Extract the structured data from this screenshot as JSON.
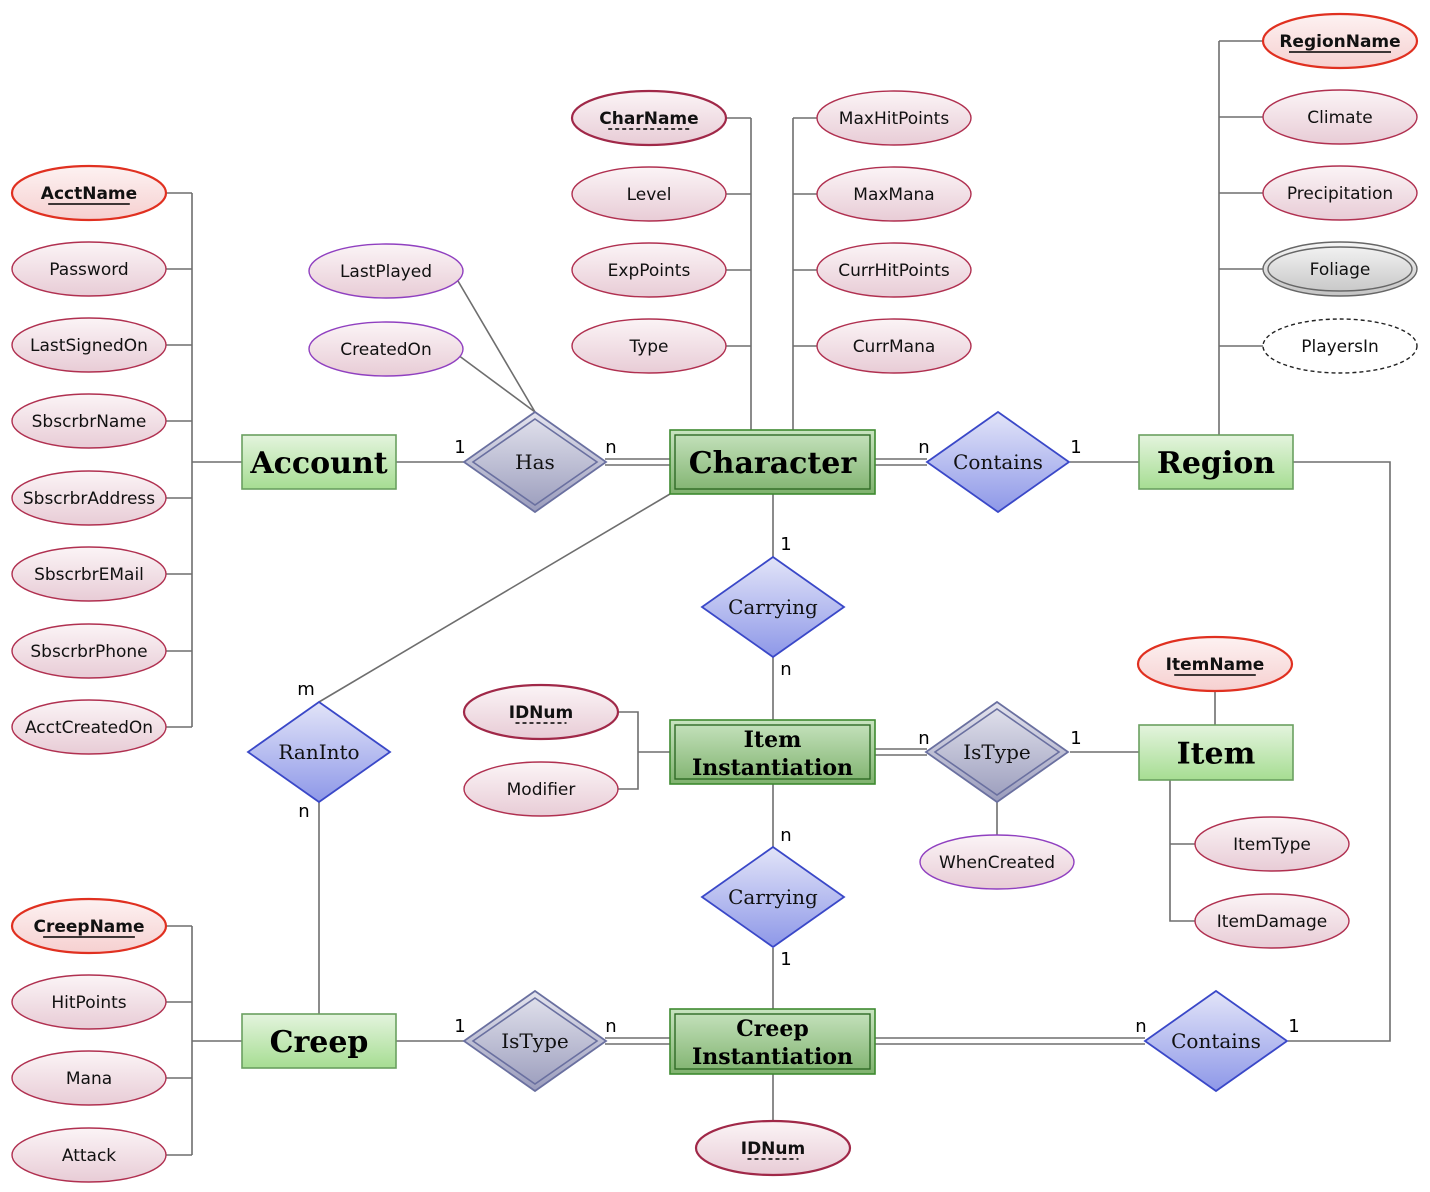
{
  "entities": [
    {
      "id": "account",
      "label": [
        "Account"
      ],
      "weak": false
    },
    {
      "id": "character",
      "label": [
        "Character"
      ],
      "weak": true
    },
    {
      "id": "region",
      "label": [
        "Region"
      ],
      "weak": false
    },
    {
      "id": "iteminst",
      "label": [
        "Item",
        "Instantiation"
      ],
      "weak": true
    },
    {
      "id": "item",
      "label": [
        "Item"
      ],
      "weak": false
    },
    {
      "id": "creep",
      "label": [
        "Creep"
      ],
      "weak": false
    },
    {
      "id": "creepinst",
      "label": [
        "Creep",
        "Instantiation"
      ],
      "weak": true
    }
  ],
  "relationships": [
    {
      "id": "has",
      "label": "Has",
      "identifying": true
    },
    {
      "id": "contains1",
      "label": "Contains",
      "identifying": false
    },
    {
      "id": "carrying1",
      "label": "Carrying",
      "identifying": false
    },
    {
      "id": "istype1",
      "label": "IsType",
      "identifying": true
    },
    {
      "id": "carrying2",
      "label": "Carrying",
      "identifying": false
    },
    {
      "id": "istype2",
      "label": "IsType",
      "identifying": true
    },
    {
      "id": "contains2",
      "label": "Contains",
      "identifying": false
    },
    {
      "id": "raninto",
      "label": "RanInto",
      "identifying": false
    }
  ],
  "attributes": [
    {
      "id": "acctname",
      "label": "AcctName",
      "kind": "key"
    },
    {
      "id": "password",
      "label": "Password",
      "kind": "normal"
    },
    {
      "id": "lastsignedon",
      "label": "LastSignedOn",
      "kind": "normal"
    },
    {
      "id": "sbscrbrname",
      "label": "SbscrbrName",
      "kind": "normal"
    },
    {
      "id": "sbscrbraddress",
      "label": "SbscrbrAddress",
      "kind": "normal"
    },
    {
      "id": "sbscrbremail",
      "label": "SbscrbrEMail",
      "kind": "normal"
    },
    {
      "id": "sbscrbrphone",
      "label": "SbscrbrPhone",
      "kind": "normal"
    },
    {
      "id": "acctcreatedon",
      "label": "AcctCreatedOn",
      "kind": "normal"
    },
    {
      "id": "lastplayed",
      "label": "LastPlayed",
      "kind": "relationship"
    },
    {
      "id": "createdon",
      "label": "CreatedOn",
      "kind": "relationship"
    },
    {
      "id": "charname",
      "label": "CharName",
      "kind": "partial-key"
    },
    {
      "id": "level",
      "label": "Level",
      "kind": "normal"
    },
    {
      "id": "exppoints",
      "label": "ExpPoints",
      "kind": "normal"
    },
    {
      "id": "type",
      "label": "Type",
      "kind": "normal"
    },
    {
      "id": "maxhitpoints",
      "label": "MaxHitPoints",
      "kind": "normal"
    },
    {
      "id": "maxmana",
      "label": "MaxMana",
      "kind": "normal"
    },
    {
      "id": "currhitpoints",
      "label": "CurrHitPoints",
      "kind": "normal"
    },
    {
      "id": "currmana",
      "label": "CurrMana",
      "kind": "normal"
    },
    {
      "id": "regionname",
      "label": "RegionName",
      "kind": "key"
    },
    {
      "id": "climate",
      "label": "Climate",
      "kind": "normal"
    },
    {
      "id": "precipitation",
      "label": "Precipitation",
      "kind": "normal"
    },
    {
      "id": "foliage",
      "label": "Foliage",
      "kind": "multivalued"
    },
    {
      "id": "playersin",
      "label": "PlayersIn",
      "kind": "derived"
    },
    {
      "id": "idnum1",
      "label": "IDNum",
      "kind": "partial-key"
    },
    {
      "id": "modifier",
      "label": "Modifier",
      "kind": "normal"
    },
    {
      "id": "itemname",
      "label": "ItemName",
      "kind": "key"
    },
    {
      "id": "whencreated",
      "label": "WhenCreated",
      "kind": "relationship"
    },
    {
      "id": "itemtype",
      "label": "ItemType",
      "kind": "normal"
    },
    {
      "id": "itemdamage",
      "label": "ItemDamage",
      "kind": "normal"
    },
    {
      "id": "creepname",
      "label": "CreepName",
      "kind": "key"
    },
    {
      "id": "hitpoints",
      "label": "HitPoints",
      "kind": "normal"
    },
    {
      "id": "mana",
      "label": "Mana",
      "kind": "normal"
    },
    {
      "id": "attack",
      "label": "Attack",
      "kind": "normal"
    },
    {
      "id": "idnum2",
      "label": "IDNum",
      "kind": "partial-key"
    }
  ],
  "cardinalities": [
    {
      "id": "has-account",
      "label": "1"
    },
    {
      "id": "has-character",
      "label": "n"
    },
    {
      "id": "contains1-character",
      "label": "n"
    },
    {
      "id": "contains1-region",
      "label": "1"
    },
    {
      "id": "carrying1-character",
      "label": "1"
    },
    {
      "id": "carrying1-iteminst",
      "label": "n"
    },
    {
      "id": "istype1-iteminst",
      "label": "n"
    },
    {
      "id": "istype1-item",
      "label": "1"
    },
    {
      "id": "carrying2-iteminst",
      "label": "n"
    },
    {
      "id": "carrying2-creepinst",
      "label": "1"
    },
    {
      "id": "istype2-creep",
      "label": "1"
    },
    {
      "id": "istype2-creepinst",
      "label": "n"
    },
    {
      "id": "contains2-creepinst",
      "label": "n"
    },
    {
      "id": "contains2-region",
      "label": "1"
    },
    {
      "id": "raninto-character",
      "label": "m"
    },
    {
      "id": "raninto-creep",
      "label": "n"
    }
  ],
  "colors": {
    "entity": "#b8e6a8",
    "weak_entity": "#90c080",
    "relationship": "#a8b0f0",
    "identifying": "#a8acc8",
    "key_stroke": "#e03020",
    "attr_stroke": "#b03050",
    "rel_attr_stroke": "#9040c0",
    "line": "#6e6e6e"
  }
}
